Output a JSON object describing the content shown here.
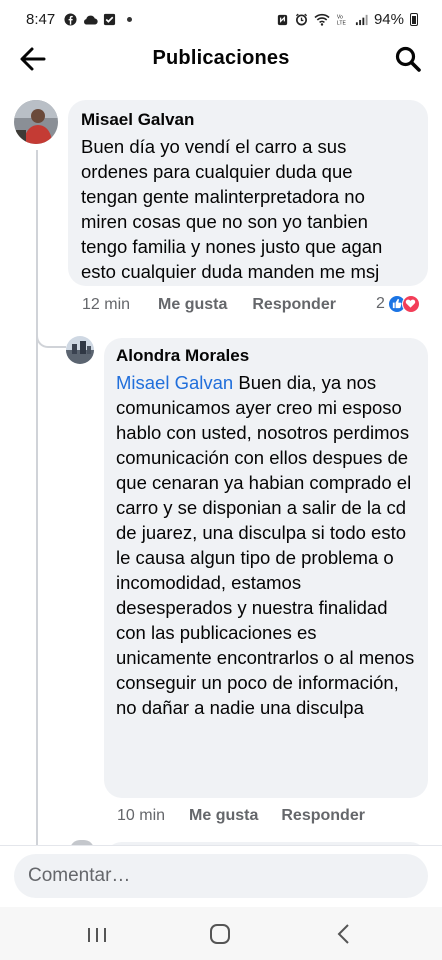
{
  "status_bar": {
    "time": "8:47",
    "battery": "94%",
    "left_icons": [
      "facebook-icon",
      "cloud-icon",
      "checkbox-icon",
      "dot"
    ],
    "right_icons": [
      "nfc-icon",
      "alarm-icon",
      "wifi-icon",
      "volte-icon",
      "signal-icon",
      "battery-icon"
    ]
  },
  "header": {
    "title": "Publicaciones",
    "back_icon": "back-arrow-icon",
    "search_icon": "search-icon"
  },
  "comments": [
    {
      "author": "Misael Galvan",
      "text": "Buen día yo vendí el carro a sus ordenes para cualquier duda que tengan gente malinterpretadora no miren cosas que no son yo tanbien tengo familia y nones justo que agan esto cualquier duda manden me msj",
      "time": "12 min",
      "like_label": "Me gusta",
      "reply_label": "Responder",
      "reaction_count": "2",
      "reactions": [
        "like-icon",
        "love-icon"
      ]
    },
    {
      "author": "Alondra Morales",
      "mention": "Misael Galvan",
      "text": "Buen dia, ya nos comunicamos ayer creo mi esposo hablo con usted, nosotros perdimos comunicación con ellos despues de que cenaran ya habian comprado el carro y se disponian a salir de la cd de juarez, una disculpa si todo esto le causa algun tipo de problema o incomodidad, estamos desesperados y nuestra finalidad con las publicaciones es unicamente encontrarlos o al menos conseguir un poco de información, no dañar a nadie una disculpa",
      "time": "10 min",
      "like_label": "Me gusta",
      "reply_label": "Responder"
    }
  ],
  "composer": {
    "placeholder": "Comentar…"
  },
  "nav": [
    "recent-apps-icon",
    "home-icon",
    "back-icon"
  ],
  "colors": {
    "bubble": "#f0f2f5",
    "mention": "#216fdb",
    "secondary_text": "#65676b",
    "like_blue": "#1b74e4",
    "love_red": "#f33e58"
  }
}
